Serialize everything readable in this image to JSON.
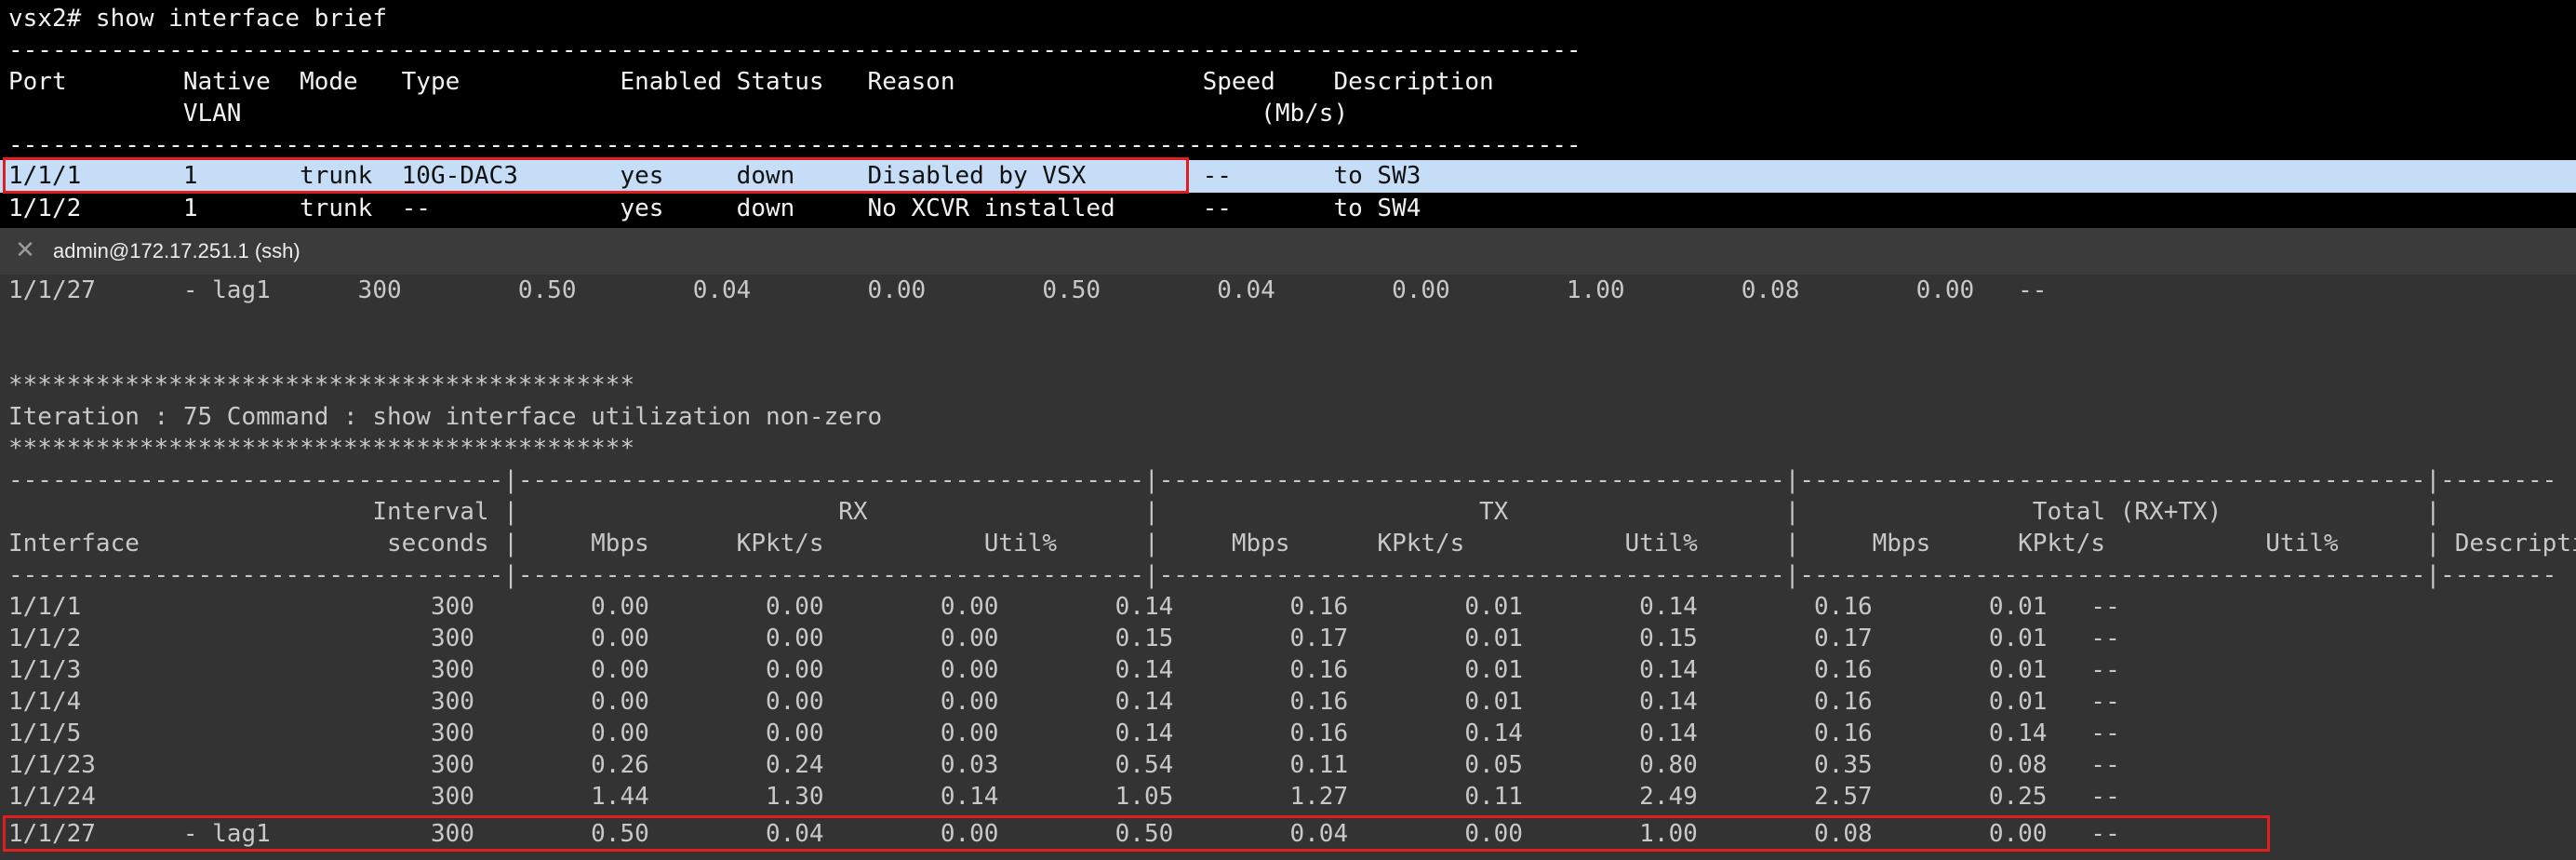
{
  "top_terminal": {
    "prompt": "vsx2# show interface brief",
    "sep": "-----------------------------------------------------------------------------------------------------------------------------------------------------------------------",
    "header1": "Port        Native  Mode   Type           Enabled Status   Reason                 Speed    Description",
    "header2": "            VLAN                                                                      (Mb/s)",
    "sep2": "-----------------------------------------------------------------------------------------------------------------------------------------------------------------------",
    "rows": [
      "1/1/1       1       trunk  10G-DAC3       yes     down     Disabled by VSX        --       to SW3",
      "1/1/2       1       trunk  --             yes     down     No XCVR installed      --       to SW4"
    ]
  },
  "tab": {
    "close_icon": "close-icon",
    "title": "admin@172.17.251.1 (ssh)"
  },
  "bottom_terminal": {
    "lines": [
      "1/1/27      - lag1      300        0.50        0.04        0.00        0.50        0.04        0.00        1.00        0.08        0.00   --",
      "",
      "",
      "*******************************************",
      "Iteration : 75 Command : show interface utilization non-zero",
      "*******************************************",
      "----------------------------------|-------------------------------------------|-------------------------------------------|-------------------------------------------|------------------------",
      "                         Interval |                      RX                   |                      TX                   |                Total (RX+TX)              |",
      "Interface                 seconds |     Mbps      KPkt/s           Util%      |     Mbps      KPkt/s           Util%      |     Mbps      KPkt/s           Util%      | Description",
      "----------------------------------|-------------------------------------------|-------------------------------------------|-------------------------------------------|------------------------",
      "1/1/1                        300        0.00        0.00        0.00        0.14        0.16        0.01        0.14        0.16        0.01   --",
      "1/1/2                        300        0.00        0.00        0.00        0.15        0.17        0.01        0.15        0.17        0.01   --",
      "1/1/3                        300        0.00        0.00        0.00        0.14        0.16        0.01        0.14        0.16        0.01   --",
      "1/1/4                        300        0.00        0.00        0.00        0.14        0.16        0.01        0.14        0.16        0.01   --",
      "1/1/5                        300        0.00        0.00        0.00        0.14        0.16        0.14        0.14        0.16        0.14   --",
      "1/1/23                       300        0.26        0.24        0.03        0.54        0.11        0.05        0.80        0.35        0.08   --",
      "1/1/24                       300        1.44        1.30        0.14        1.05        1.27        0.11        2.49        2.57        0.25   --",
      "1/1/27      - lag1           300        0.50        0.04        0.00        0.50        0.04        0.00        1.00        0.08        0.00   --"
    ]
  },
  "colors": {
    "terminal_bg_top": "#000000",
    "terminal_bg_bottom": "#333333",
    "selection_highlight": "#c6ddf8",
    "annotation_box": "#e11d1d"
  }
}
